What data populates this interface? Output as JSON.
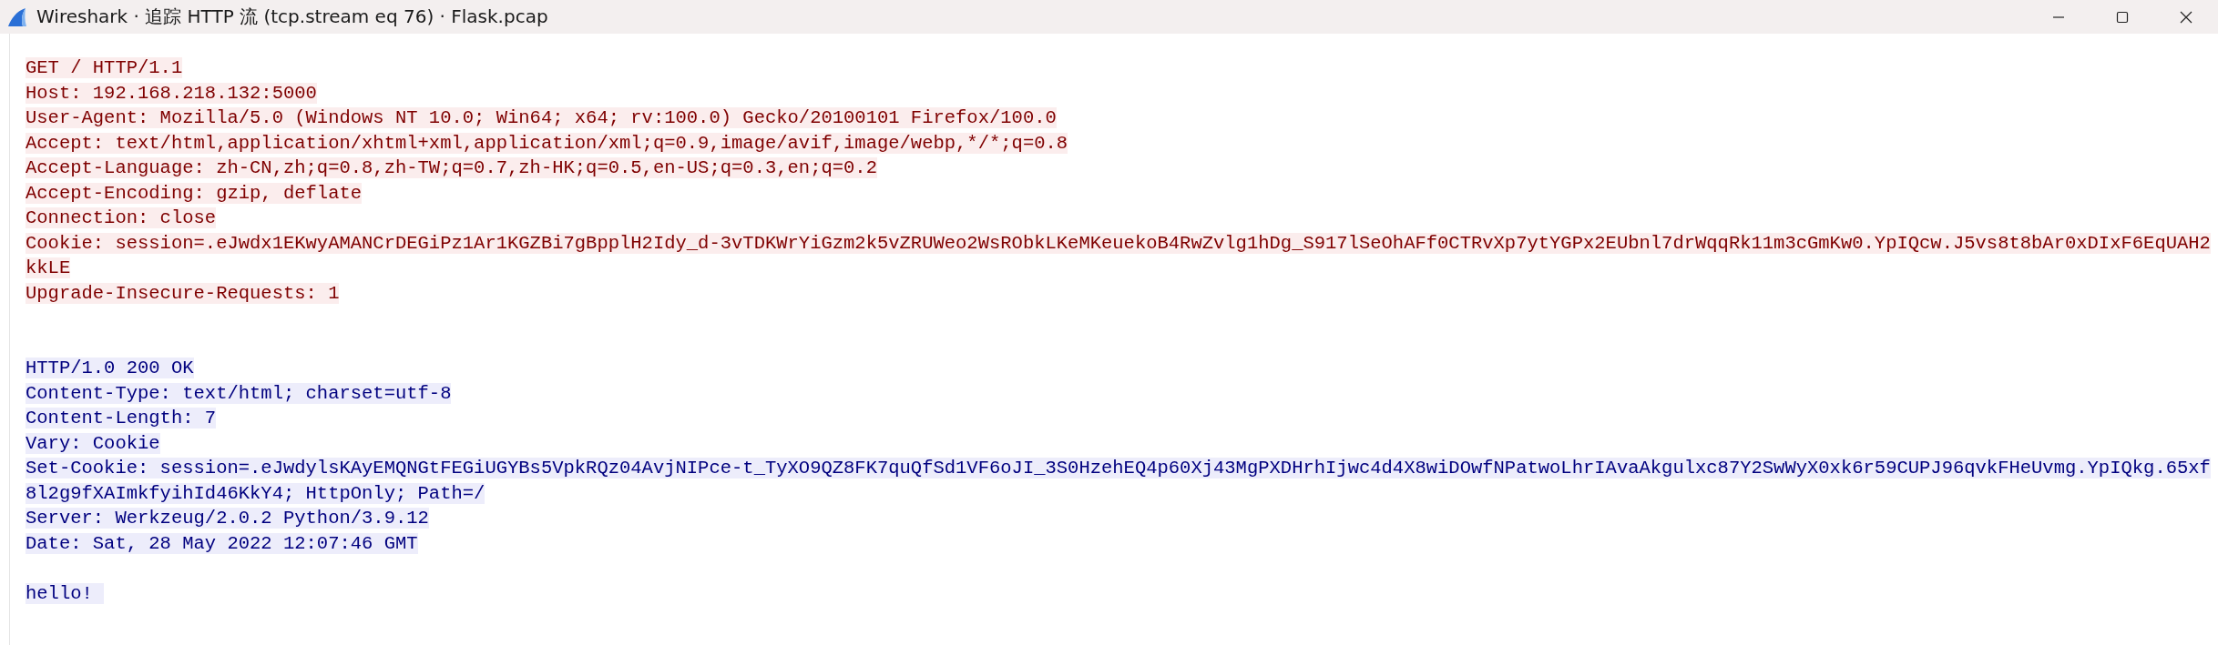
{
  "window": {
    "title": "Wireshark · 追踪 HTTP 流 (tcp.stream eq 76) · Flask.pcap"
  },
  "stream": [
    {
      "kind": "client",
      "lines": [
        "GET / HTTP/1.1",
        "Host: 192.168.218.132:5000",
        "User-Agent: Mozilla/5.0 (Windows NT 10.0; Win64; x64; rv:100.0) Gecko/20100101 Firefox/100.0",
        "Accept: text/html,application/xhtml+xml,application/xml;q=0.9,image/avif,image/webp,*/*;q=0.8",
        "Accept-Language: zh-CN,zh;q=0.8,zh-TW;q=0.7,zh-HK;q=0.5,en-US;q=0.3,en;q=0.2",
        "Accept-Encoding: gzip, deflate",
        "Connection: close",
        "Cookie: session=.eJwdx1EKwyAMANCrDEGiPz1Ar1KGZBi7gBpplH2Idy_d-3vTDKWrYiGzm2k5vZRUWeo2WsRObkLKeMKeuekoB4RwZvlg1hDg_S917lSeOhAFf0CTRvXp7ytYGPx2EUbnl7drWqqRk11m3cGmKw0.YpIQcw.J5vs8t8bAr0xDIxF6EqUAH2",
        "kkLE",
        "Upgrade-Insecure-Requests: 1"
      ]
    },
    {
      "kind": "server",
      "lines": [
        "HTTP/1.0 200 OK",
        "Content-Type: text/html; charset=utf-8",
        "Content-Length: 7",
        "Vary: Cookie",
        "Set-Cookie: session=.eJwdylsKAyEMQNGtFEGiUGYBs5VpkRQz04AvjNIPce-t_TyXO9QZ8FK7quQfSd1VF6oJI_3S0HzehEQ4p60Xj43MgPXDHrhIjwc4d4X8wiDOwfNPatwoLhrIAvaAkgulxc87Y2SwWyX0xk6r59CUPJ96qvkFHeUvmg.YpIQkg.65xf",
        "8l2g9fXAImkfyihId46KkY4; HttpOnly; Path=/",
        "Server: Werkzeug/2.0.2 Python/3.9.12",
        "Date: Sat, 28 May 2022 12:07:46 GMT"
      ]
    },
    {
      "kind": "server",
      "lines": [
        "hello! "
      ]
    }
  ]
}
